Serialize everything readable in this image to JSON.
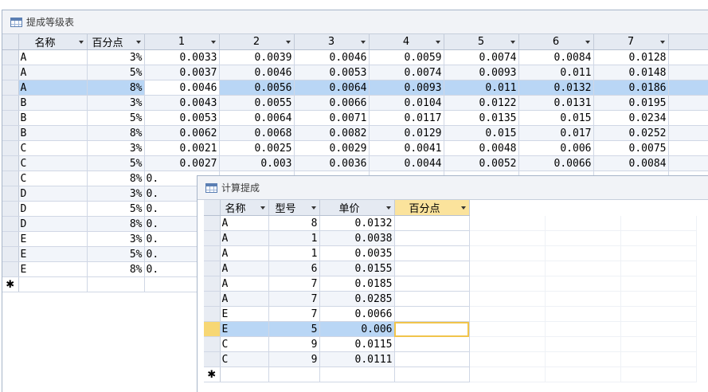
{
  "win1": {
    "title": "提成等级表",
    "headers": [
      "名称",
      "百分点",
      "1",
      "2",
      "3",
      "4",
      "5",
      "6",
      "7"
    ],
    "rows": [
      [
        "A",
        "3%",
        "0.0033",
        "0.0039",
        "0.0046",
        "0.0059",
        "0.0074",
        "0.0084",
        "0.0128"
      ],
      [
        "A",
        "5%",
        "0.0037",
        "0.0046",
        "0.0053",
        "0.0074",
        "0.0093",
        "0.011",
        "0.0148"
      ],
      [
        "A",
        "8%",
        "0.0046",
        "0.0056",
        "0.0064",
        "0.0093",
        "0.011",
        "0.0132",
        "0.0186"
      ],
      [
        "B",
        "3%",
        "0.0043",
        "0.0055",
        "0.0066",
        "0.0104",
        "0.0122",
        "0.0131",
        "0.0195"
      ],
      [
        "B",
        "5%",
        "0.0053",
        "0.0064",
        "0.0071",
        "0.0117",
        "0.0135",
        "0.015",
        "0.0234"
      ],
      [
        "B",
        "8%",
        "0.0062",
        "0.0068",
        "0.0082",
        "0.0129",
        "0.015",
        "0.017",
        "0.0252"
      ],
      [
        "C",
        "3%",
        "0.0021",
        "0.0025",
        "0.0029",
        "0.0041",
        "0.0048",
        "0.006",
        "0.0075"
      ],
      [
        "C",
        "5%",
        "0.0027",
        "0.003",
        "0.0036",
        "0.0044",
        "0.0052",
        "0.0066",
        "0.0084"
      ],
      [
        "C",
        "8%",
        "0.",
        "",
        "",
        "",
        "",
        "",
        ""
      ],
      [
        "D",
        "3%",
        "0.",
        "",
        "",
        "",
        "",
        "",
        ""
      ],
      [
        "D",
        "5%",
        "0.",
        "",
        "",
        "",
        "",
        "",
        ""
      ],
      [
        "D",
        "8%",
        "0.",
        "",
        "",
        "",
        "",
        "",
        ""
      ],
      [
        "E",
        "3%",
        "0.",
        "",
        "",
        "",
        "",
        "",
        ""
      ],
      [
        "E",
        "5%",
        "0.",
        "",
        "",
        "",
        "",
        "",
        ""
      ],
      [
        "E",
        "8%",
        "0.",
        "",
        "",
        "",
        "",
        "",
        ""
      ]
    ],
    "new_row_marker": "✱"
  },
  "win2": {
    "title": "计算提成",
    "headers": [
      "名称",
      "型号",
      "单价",
      "百分点"
    ],
    "rows": [
      [
        "A",
        "8",
        "0.0132",
        ""
      ],
      [
        "A",
        "1",
        "0.0038",
        ""
      ],
      [
        "A",
        "1",
        "0.0035",
        ""
      ],
      [
        "A",
        "6",
        "0.0155",
        ""
      ],
      [
        "A",
        "7",
        "0.0185",
        ""
      ],
      [
        "A",
        "7",
        "0.0285",
        ""
      ],
      [
        "E",
        "7",
        "0.0066",
        ""
      ],
      [
        "E",
        "5",
        "0.006",
        ""
      ],
      [
        "C",
        "9",
        "0.0115",
        ""
      ],
      [
        "C",
        "9",
        "0.0111",
        ""
      ]
    ],
    "new_row_marker": "✱"
  },
  "colors": {
    "highlight": "#b9d6f5",
    "selected_header": "#fbe39c",
    "selector_active": "#f7d774"
  }
}
